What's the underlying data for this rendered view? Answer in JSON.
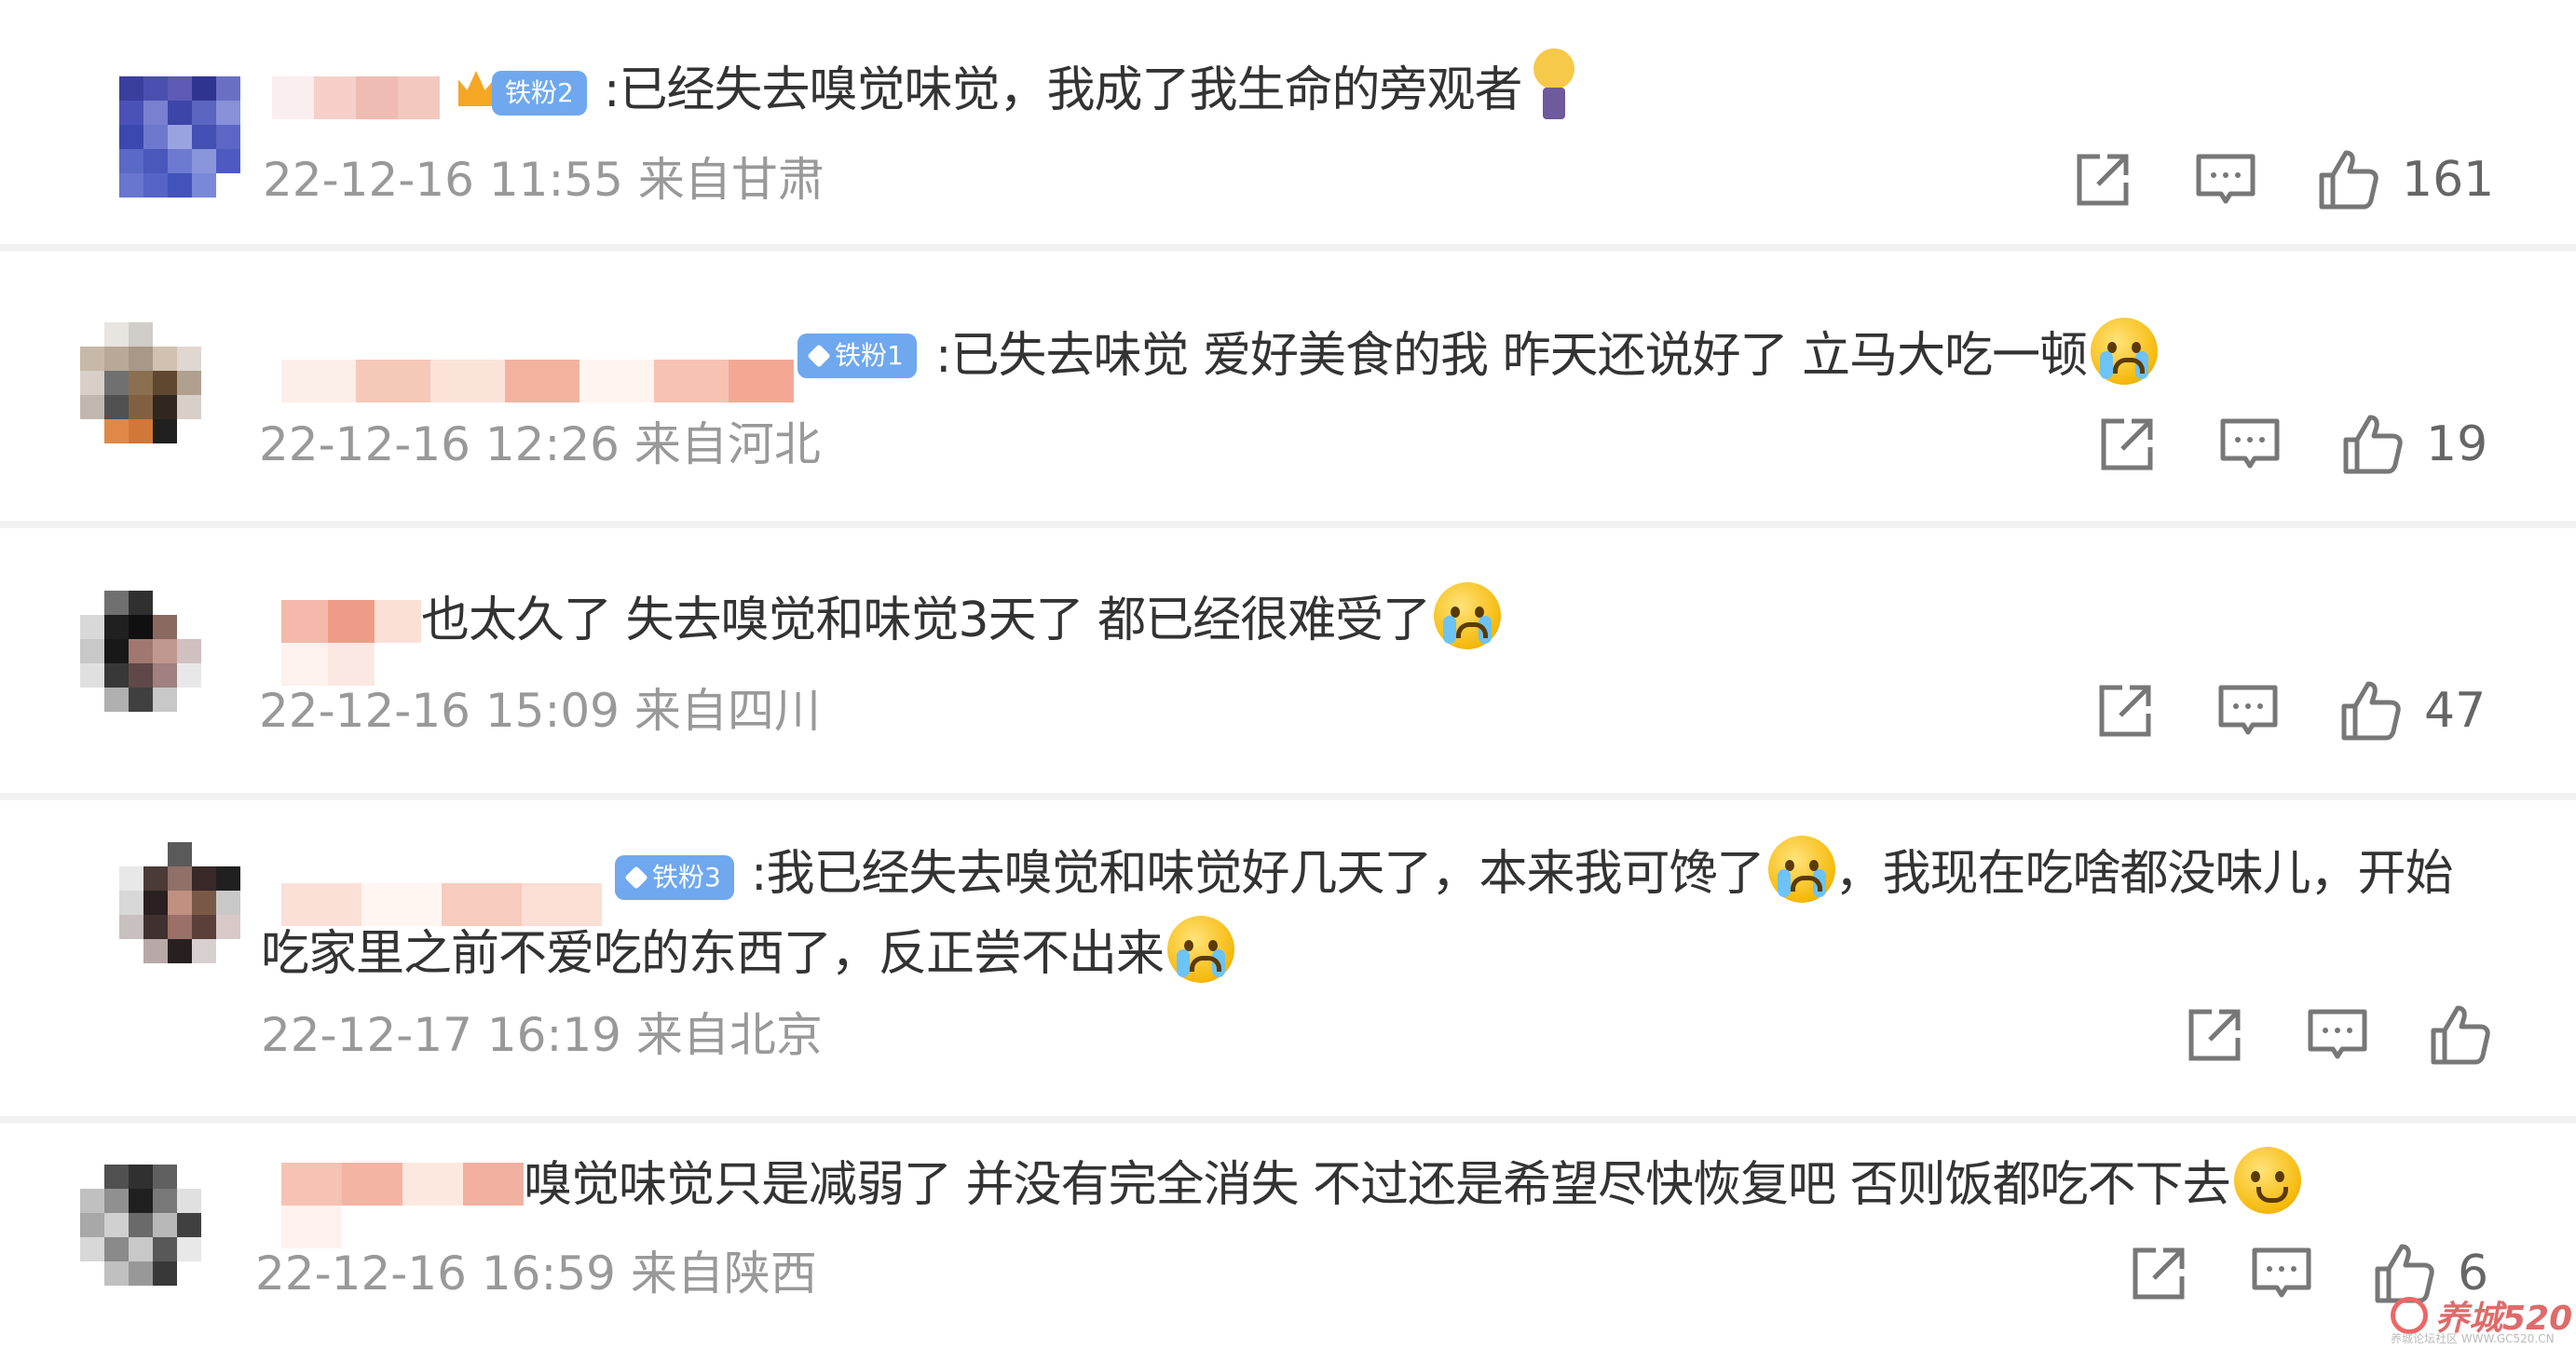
{
  "colors": {
    "badge": "#6fa8ef",
    "text": "#333333",
    "meta": "#999999",
    "accent_emoji": "#f6b90a"
  },
  "icons": {
    "share": "share-icon",
    "comment": "comment-icon",
    "like": "thumbs-up-icon"
  },
  "comments": [
    {
      "badge": "铁粉2",
      "text": ":已经失去嗅觉味觉，我成了我生命的旁观者",
      "time": "22-12-16 11:55",
      "location": "来自甘肃",
      "likes": "161",
      "emoji": "light-bulb-emoji"
    },
    {
      "badge": "铁粉1",
      "text": ":已失去味觉 爱好美食的我 昨天还说好了 立马大吃一顿",
      "time": "22-12-16 12:26",
      "location": "来自河北",
      "likes": "19",
      "emoji": "crying-face-emoji"
    },
    {
      "badge": "",
      "text": "也太久了 失去嗅觉和味觉3天了 都已经很难受了",
      "time": "22-12-16 15:09",
      "location": "来自四川",
      "likes": "47",
      "emoji": "crying-face-emoji"
    },
    {
      "badge": "铁粉3",
      "text_part1": ":我已经失去嗅觉和味觉好几天了，本来我可馋了",
      "text_part2": "，我现在吃啥都没味儿，开始",
      "text_line2": "吃家里之前不爱吃的东西了，反正尝不出来",
      "time": "22-12-17 16:19",
      "location": "来自北京",
      "likes": "",
      "emoji": "crying-face-emoji"
    },
    {
      "badge": "",
      "text": "嗅觉味觉只是减弱了 并没有完全消失 不过还是希望尽快恢复吧 否则饭都吃不下去",
      "time": "22-12-16 16:59",
      "location": "来自陕西",
      "likes": "6",
      "emoji": "pleading-face-emoji"
    }
  ],
  "watermark": {
    "text": "养城520",
    "sub": "养城论坛社区 WWW.GC520.CN"
  }
}
